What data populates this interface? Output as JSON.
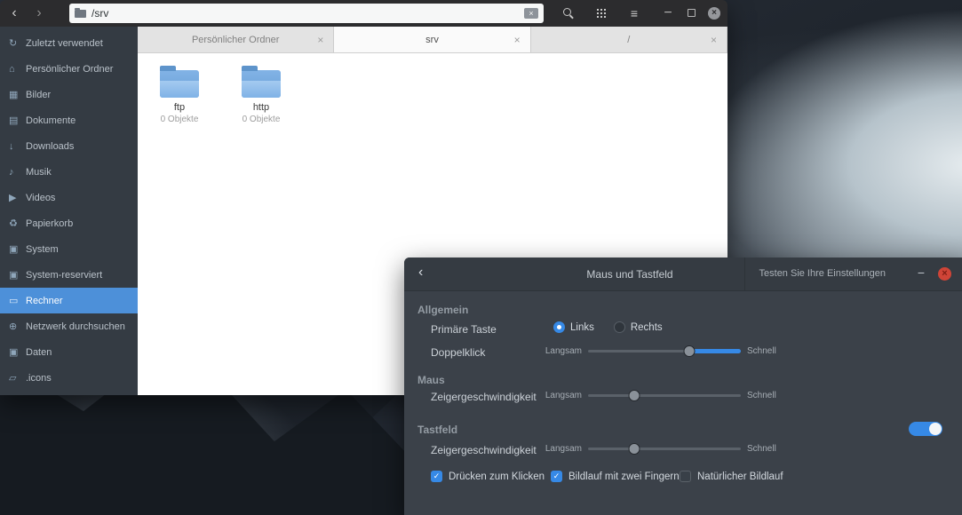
{
  "ui": {
    "back_glyph": "‹",
    "forward_glyph": "›",
    "menu_glyph": "≡",
    "minus_glyph": "−",
    "close_glyph": "×"
  },
  "colors": {
    "accent": "#3689e6",
    "selection_blue": "#4d90d9",
    "close_red": "#cf4437"
  },
  "files_window": {
    "toolbar": {
      "path": "/srv"
    },
    "tabs": [
      {
        "label": "Persönlicher Ordner",
        "active": false
      },
      {
        "label": "srv",
        "active": true
      },
      {
        "label": "/",
        "active": false
      }
    ],
    "sidebar": {
      "items": [
        {
          "icon": "recent-icon",
          "glyph": "↻",
          "label": "Zuletzt verwendet"
        },
        {
          "icon": "home-icon",
          "glyph": "⌂",
          "label": "Persönlicher Ordner"
        },
        {
          "icon": "images-icon",
          "glyph": "▦",
          "label": "Bilder"
        },
        {
          "icon": "documents-icon",
          "glyph": "▤",
          "label": "Dokumente"
        },
        {
          "icon": "downloads-icon",
          "glyph": "↓",
          "label": "Downloads"
        },
        {
          "icon": "music-icon",
          "glyph": "♪",
          "label": "Musik"
        },
        {
          "icon": "videos-icon",
          "glyph": "▶",
          "label": "Videos"
        },
        {
          "icon": "trash-icon",
          "glyph": "♻",
          "label": "Papierkorb"
        },
        {
          "icon": "disk-icon",
          "glyph": "▣",
          "label": "System"
        },
        {
          "icon": "disk-icon",
          "glyph": "▣",
          "label": "System-reserviert"
        },
        {
          "icon": "computer-icon",
          "glyph": "▭",
          "label": "Rechner",
          "selected": true
        },
        {
          "icon": "network-icon",
          "glyph": "⊕",
          "label": "Netzwerk durchsuchen"
        },
        {
          "icon": "disk-icon",
          "glyph": "▣",
          "label": "Daten"
        },
        {
          "icon": "folder-icon",
          "glyph": "▱",
          "label": ".icons"
        }
      ]
    },
    "content": {
      "items": [
        {
          "name": "ftp",
          "count": "0 Objekte"
        },
        {
          "name": "http",
          "count": "0 Objekte"
        }
      ]
    }
  },
  "settings_window": {
    "header": {
      "title": "Maus und Tastfeld",
      "test_button": "Testen Sie Ihre Einstellungen"
    },
    "slider_labels": {
      "slow": "Langsam",
      "fast": "Schnell"
    },
    "general": {
      "heading": "Allgemein",
      "primary_label": "Primäre Taste",
      "radio_left": "Links",
      "radio_right": "Rechts",
      "radio_selected": "Links",
      "doubleclick_label": "Doppelklick"
    },
    "mouse": {
      "heading": "Maus",
      "speed_label": "Zeigergeschwindigkeit"
    },
    "touchpad": {
      "heading": "Tastfeld",
      "enabled": true,
      "speed_label": "Zeigergeschwindigkeit",
      "tap_to_click": {
        "label": "Drücken zum Klicken",
        "checked": true
      },
      "two_finger_scroll": {
        "label": "Bildlauf mit zwei Fingern",
        "checked": true
      },
      "natural_scroll": {
        "label": "Natürlicher Bildlauf",
        "checked": false
      }
    },
    "sliders": {
      "doubleclick": {
        "knob_pct": 66
      },
      "mouse_speed": {
        "knob_pct": 30
      },
      "touchpad_speed": {
        "knob_pct": 30
      }
    }
  }
}
